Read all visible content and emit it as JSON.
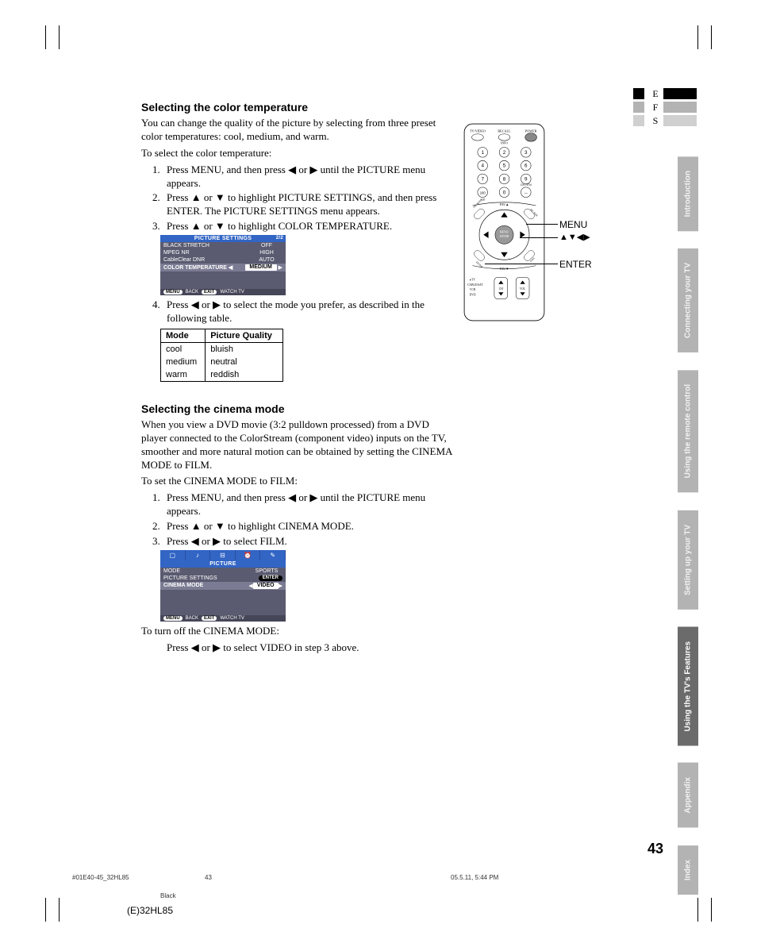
{
  "lang": {
    "e": "E",
    "f": "F",
    "s": "S"
  },
  "sideTabs": [
    "Introduction",
    "Connecting your TV",
    "Using the remote control",
    "Setting up your TV",
    "Using the TV's Features",
    "Appendix",
    "Index"
  ],
  "section1": {
    "heading": "Selecting the color temperature",
    "p1": "You can change the quality of the picture by selecting from three preset color temperatures: cool, medium, and warm.",
    "p2": "To select the color temperature:",
    "steps": {
      "s1": "Press MENU, and then press ◀ or ▶ until the PICTURE menu appears.",
      "s2": "Press ▲ or ▼ to highlight PICTURE SETTINGS, and then press ENTER. The PICTURE SETTINGS menu appears.",
      "s3": "Press ▲ or ▼ to highlight COLOR TEMPERATURE.",
      "s4": "Press ◀ or ▶ to select the mode you prefer, as described in the following table."
    }
  },
  "osd1": {
    "title": "PICTURE SETTINGS",
    "page": "2/2",
    "rows": [
      {
        "label": "BLACK STRETCH",
        "value": "OFF"
      },
      {
        "label": "MPEG NR",
        "value": "HIGH"
      },
      {
        "label": "CableClear DNR",
        "value": "AUTO"
      },
      {
        "label": "COLOR TEMPERATURE",
        "value": "MEDIUM",
        "selected": true
      }
    ],
    "footer": {
      "menu": "MENU",
      "back": "BACK",
      "exit": "EXIT",
      "watch": "WATCH TV"
    }
  },
  "modeTable": {
    "head": [
      "Mode",
      "Picture Quality"
    ],
    "rows": [
      [
        "cool",
        "bluish"
      ],
      [
        "medium",
        "neutral"
      ],
      [
        "warm",
        "reddish"
      ]
    ]
  },
  "section2": {
    "heading": "Selecting the cinema mode",
    "p1": "When you view a DVD movie (3:2 pulldown processed) from a DVD player connected to the ColorStream (component video) inputs on the TV, smoother and more natural motion can be obtained by setting the CINEMA MODE to FILM.",
    "p2": "To set the CINEMA MODE to FILM:",
    "steps": {
      "s1": "Press MENU, and then press ◀ or ▶ until the PICTURE menu appears.",
      "s2": "Press ▲ or ▼ to highlight CINEMA MODE.",
      "s3": "Press ◀ or ▶ to select FILM."
    },
    "p3": "To turn off the CINEMA MODE:",
    "p4": "Press ◀ or ▶ to select VIDEO in step 3 above."
  },
  "osd2": {
    "title": "PICTURE",
    "rows": [
      {
        "label": "MODE",
        "value": "SPORTS"
      },
      {
        "label": "PICTURE SETTINGS",
        "value": "ENTER",
        "enter": true
      },
      {
        "label": "CINEMA MODE",
        "value": "VIDEO",
        "selected": true
      }
    ],
    "footer": {
      "menu": "MENU",
      "back": "BACK",
      "exit": "EXIT",
      "watch": "WATCH TV"
    }
  },
  "remoteLabels": {
    "menu": "MENU",
    "arrows": "▲▼◀▶",
    "enter": "ENTER"
  },
  "remote": {
    "top": {
      "tvvideo": "TV/VIDEO",
      "recall": "RECALL",
      "info": "INFO",
      "power": "POWER"
    },
    "digits": [
      "1",
      "2",
      "3",
      "4",
      "5",
      "6",
      "7",
      "8",
      "9",
      "100",
      "0",
      "—"
    ],
    "chrtn": "CH RTN",
    "plus10": "+10",
    "favup": "FAV▲",
    "favdn": "FAV▼",
    "menu": "MENU",
    "center": "MENU / ENTER",
    "exit": "EXIT",
    "enter": "ENTER",
    "bottom": {
      "tv": "TV",
      "cablesat": "CABLE/SAT",
      "vcr": "VCR",
      "dvd": "DVD",
      "ch": "CH",
      "vol": "VOL"
    }
  },
  "pageNum": "43",
  "footer": {
    "left": "#01E40-45_32HL85",
    "center": "43",
    "right": "05.5.11, 5:44 PM",
    "black": "Black"
  },
  "model": "(E)32HL85"
}
